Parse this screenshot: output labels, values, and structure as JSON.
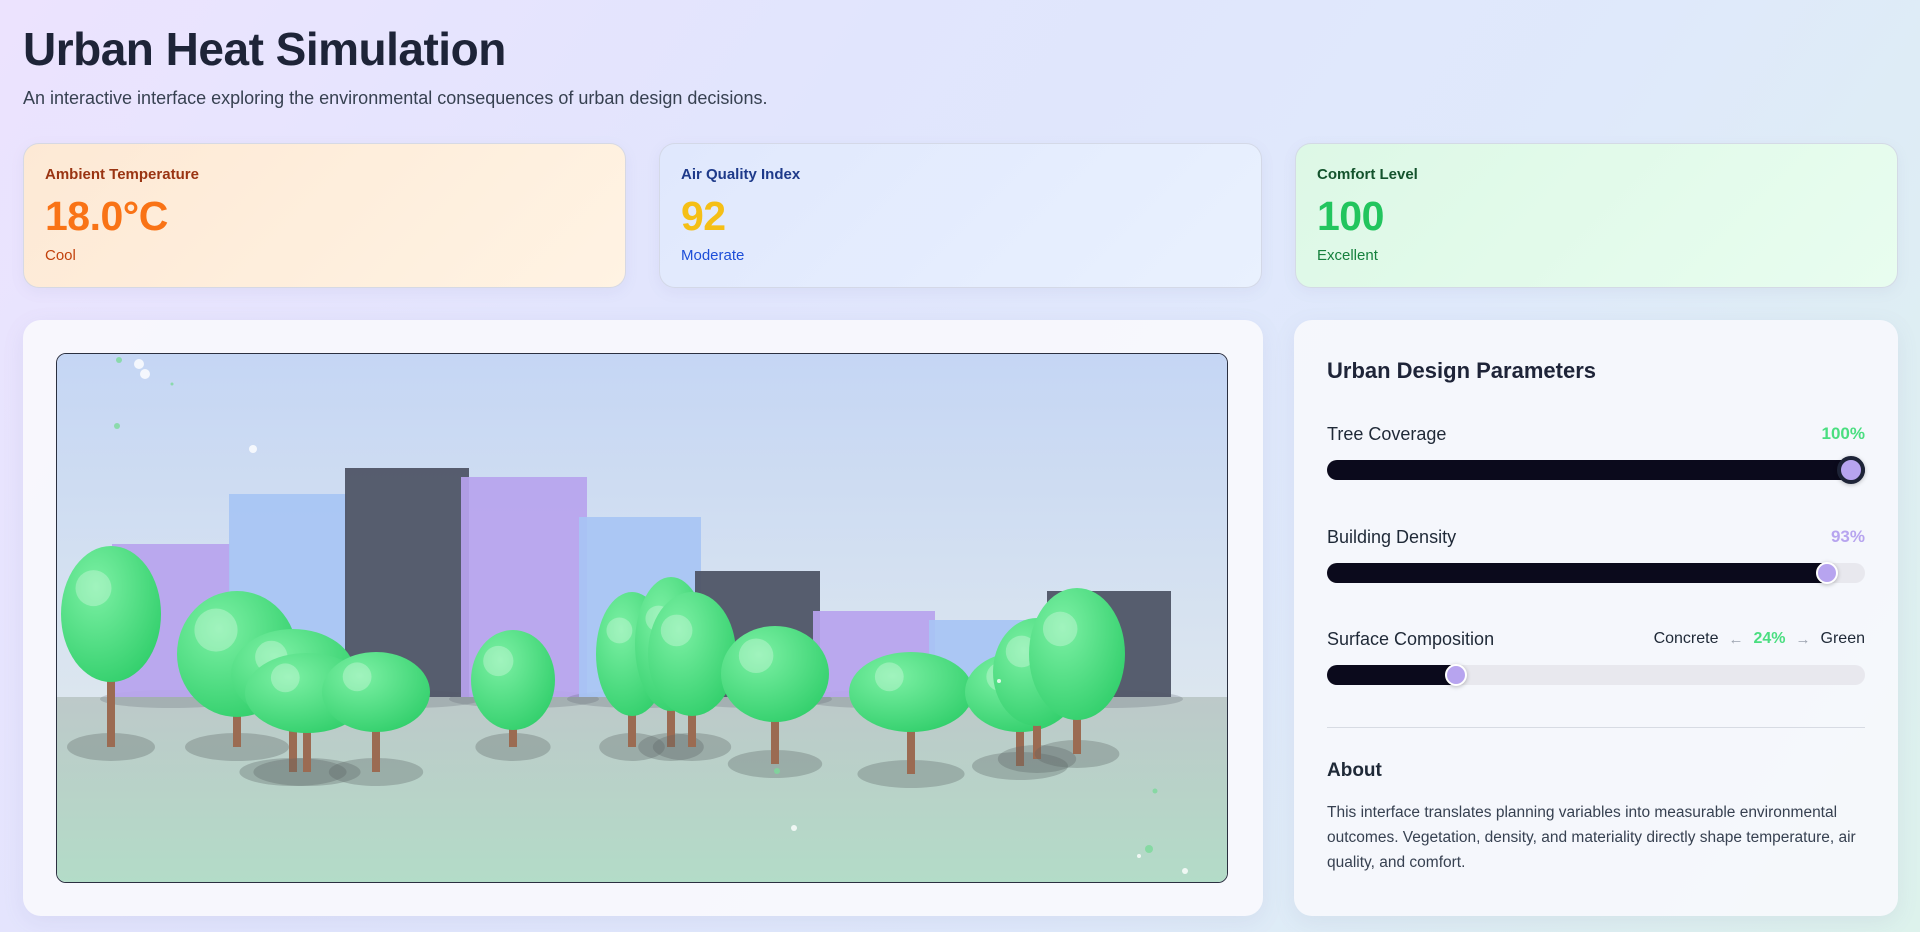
{
  "header": {
    "title": "Urban Heat Simulation",
    "subtitle": "An interactive interface exploring the environmental consequences of urban design decisions."
  },
  "metrics": {
    "temperature": {
      "label": "Ambient Temperature",
      "value": "18.0°C",
      "status": "Cool",
      "color": "#f97316"
    },
    "air_quality": {
      "label": "Air Quality Index",
      "value": "92",
      "status": "Moderate",
      "color": "#f5bf16"
    },
    "comfort": {
      "label": "Comfort Level",
      "value": "100",
      "status": "Excellent",
      "color": "#22c55e"
    }
  },
  "scene": {
    "sky_colors": [
      "#c5d6f4",
      "#dce6ef"
    ],
    "ground_colors": [
      "#bdc9c9",
      "#b3dcc8"
    ],
    "building_colors": {
      "purple": "#b7a3ee",
      "blue": "#a7c4f4",
      "dark": "#4f5566"
    },
    "tree_color": "#4ade80",
    "trunk_color": "#9b6b52"
  },
  "parameters": {
    "title": "Urban Design Parameters",
    "tree_coverage": {
      "label": "Tree Coverage",
      "value_text": "100%",
      "value": 100,
      "color": "#4ade80"
    },
    "building_density": {
      "label": "Building Density",
      "value_text": "93%",
      "value": 93,
      "color": "#b7a4ef"
    },
    "surface_composition": {
      "label": "Surface Composition",
      "left_label": "Concrete",
      "left_arrow": "←",
      "value_text": "24%",
      "right_arrow": "→",
      "right_label": "Green",
      "value": 24
    }
  },
  "about": {
    "title": "About",
    "text": "This interface translates planning variables into measurable environmental outcomes. Vegetation, density, and materiality directly shape temperature, air quality, and comfort."
  }
}
